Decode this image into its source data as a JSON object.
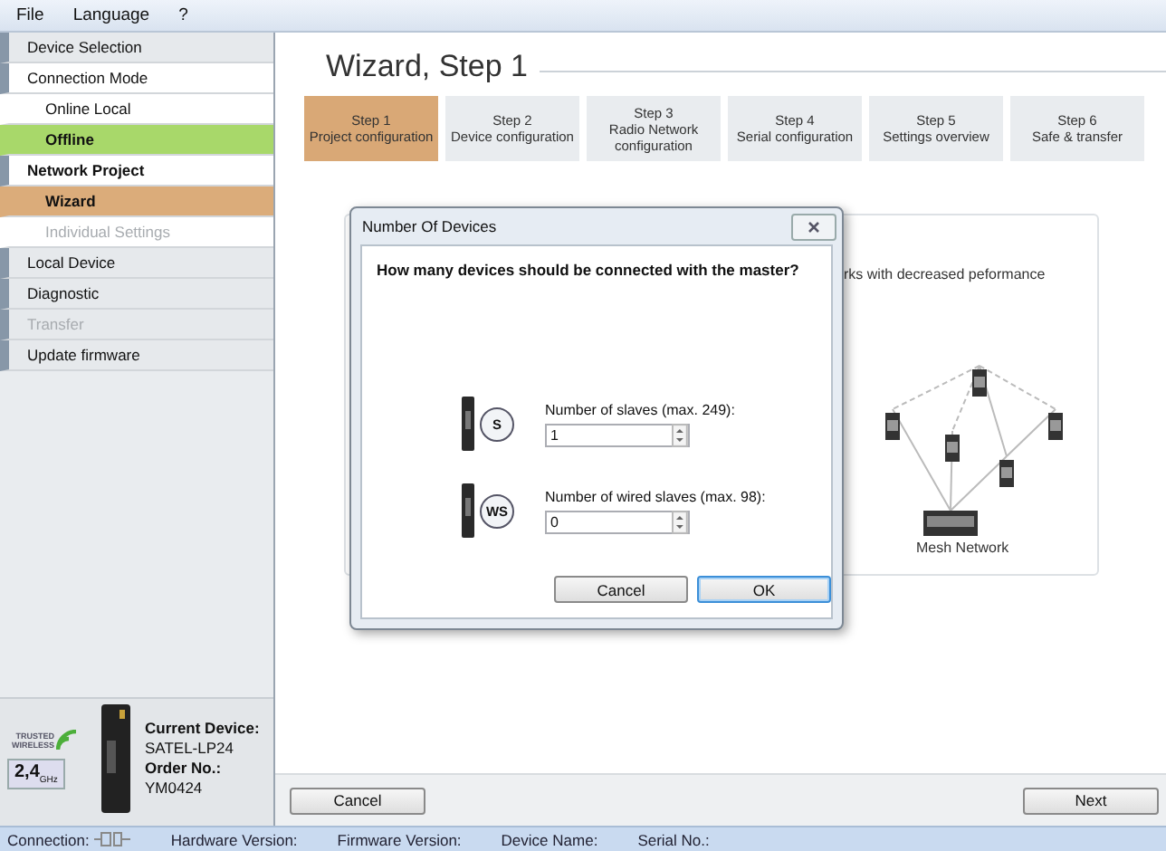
{
  "menu": [
    {
      "label": "File"
    },
    {
      "label": "Language"
    },
    {
      "label": "?"
    }
  ],
  "sidebar": {
    "items": [
      {
        "label": "Device Selection",
        "expanded": false,
        "active": false,
        "disabled": false
      },
      {
        "label": "Connection Mode",
        "expanded": true,
        "active": false,
        "disabled": false,
        "children": [
          {
            "label": "Online Local",
            "selected": false,
            "disabled": false
          },
          {
            "label": "Offline",
            "selected": true,
            "disabled": false,
            "color": "#a8d86a"
          }
        ]
      },
      {
        "label": "Network Project",
        "expanded": true,
        "active": true,
        "disabled": false,
        "children": [
          {
            "label": "Wizard",
            "selected": true,
            "disabled": false,
            "color": "#dbac7a"
          },
          {
            "label": "Individual Settings",
            "selected": false,
            "disabled": true
          }
        ]
      },
      {
        "label": "Local Device",
        "expanded": false,
        "active": false,
        "disabled": false
      },
      {
        "label": "Diagnostic",
        "expanded": false,
        "active": false,
        "disabled": false
      },
      {
        "label": "Transfer",
        "expanded": false,
        "active": false,
        "disabled": true
      },
      {
        "label": "Update firmware",
        "expanded": false,
        "active": false,
        "disabled": false
      }
    ],
    "device": {
      "logo": "TRUSTED WIRELESS",
      "band": "2,4$_{GHz}$",
      "current_label": "Current Device:",
      "current_value": "SATEL-LP24",
      "order_label": "Order No.:",
      "order_value": "YM0424"
    }
  },
  "wizard": {
    "title": "Wizard, Step 1",
    "steps": [
      {
        "label": "Step 1",
        "caption": "Project configuration",
        "selected": true
      },
      {
        "label": "Step 2",
        "caption": "Device configuration",
        "selected": false
      },
      {
        "label": "Step 3",
        "caption": "Radio Network configuration",
        "selected": false
      },
      {
        "label": "Step 4",
        "caption": "Serial configuration",
        "selected": false
      },
      {
        "label": "Step 5",
        "caption": "Settings overview",
        "selected": false
      },
      {
        "label": "Step 6",
        "caption": "Safe & transfer",
        "selected": false
      }
    ],
    "card": {
      "text": "rks with decreased peformance",
      "caption": "Mesh Network"
    },
    "buttons": [
      {
        "label": "Cancel"
      },
      {
        "label": "Next"
      }
    ]
  },
  "dialog": {
    "title": "Number Of Devices",
    "question": "How many devices should be connected with the master?",
    "fields": [
      {
        "badge": "S",
        "label": "Number of slaves (max. 249):",
        "value": "1"
      },
      {
        "badge": "WS",
        "label": "Number of wired slaves (max. 98):",
        "value": "0"
      }
    ],
    "buttons": [
      {
        "label": "Cancel",
        "default": false
      },
      {
        "label": "OK",
        "default": true
      }
    ]
  },
  "status_bar": [
    {
      "label": "Connection:",
      "kind": "connection"
    },
    {
      "label": "Hardware Version:",
      "kind": "text"
    },
    {
      "label": "Firmware Version:",
      "kind": "text"
    },
    {
      "label": "Device Name:",
      "kind": "text"
    },
    {
      "label": "Serial No.:",
      "kind": "text"
    }
  ]
}
